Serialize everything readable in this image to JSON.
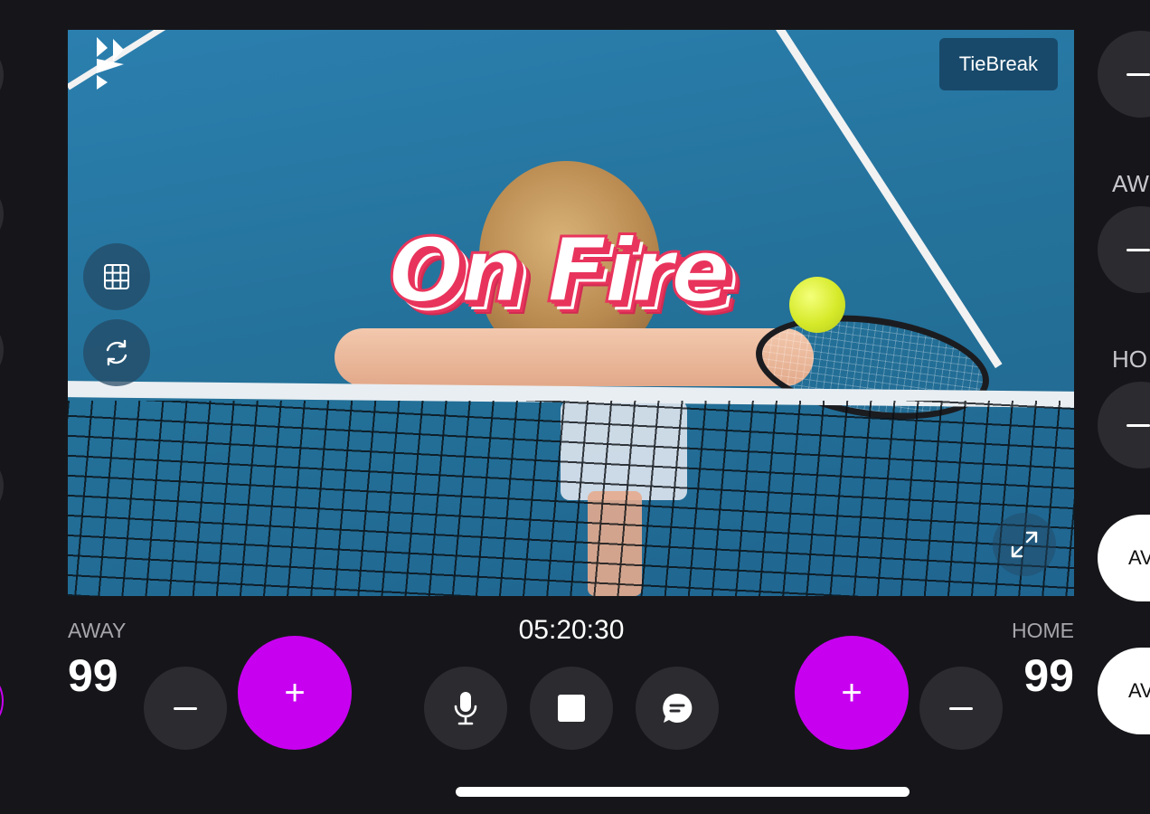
{
  "video": {
    "badge_label": "TieBreak",
    "overlay_text": "On Fire",
    "tools": [
      {
        "icon": "grid-icon"
      },
      {
        "icon": "refresh-icon"
      },
      {
        "icon": "expand-icon"
      }
    ],
    "logo": "brand-logo"
  },
  "scoreboard": {
    "away": {
      "label": "AWAY",
      "score": "99"
    },
    "home": {
      "label": "HOME",
      "score": "99"
    },
    "timer": "05:20:30",
    "increment_label": "+",
    "colors": {
      "accent": "#c800f0",
      "button": "#2c2c30",
      "background": "#16161a"
    }
  },
  "media_controls": [
    {
      "icon": "microphone-icon"
    },
    {
      "icon": "stop-icon"
    },
    {
      "icon": "chat-icon"
    }
  ],
  "right_panel": {
    "labels": [
      "AW",
      "HO"
    ],
    "pill_labels": [
      "AV",
      "AV"
    ]
  }
}
